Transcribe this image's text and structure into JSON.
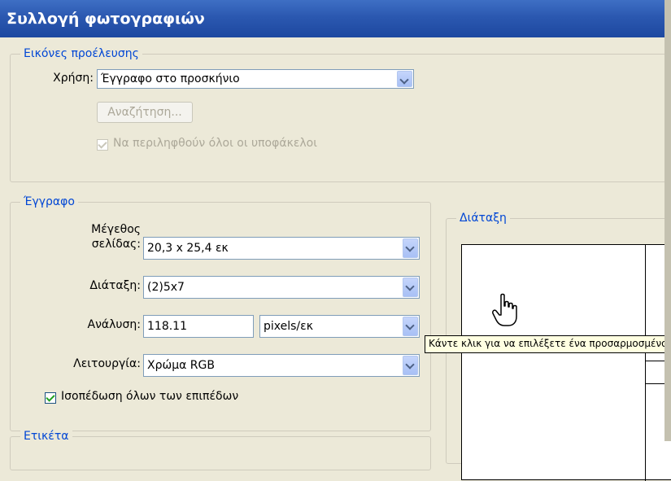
{
  "window": {
    "title": "Συλλογή φωτογραφιών"
  },
  "source": {
    "group_title": "Εικόνες προέλευσης",
    "use_label": "Χρήση:",
    "use_value": "Έγγραφο στο προσκήνιο",
    "browse_label": "Αναζήτηση...",
    "include_subfolders_label": "Να περιληφθούν όλοι οι υποφάκελοι",
    "include_subfolders_checked": true
  },
  "document": {
    "group_title": "Έγγραφο",
    "page_size_label_1": "Μέγεθος",
    "page_size_label_2": "σελίδας:",
    "page_size_value": "20,3 x 25,4 εκ",
    "layout_label": "Διάταξη:",
    "layout_value": "(2)5x7",
    "resolution_label": "Ανάλυση:",
    "resolution_value": "118.11",
    "resolution_unit": "pixels/εκ",
    "mode_label": "Λειτουργία:",
    "mode_value": "Χρώμα RGB",
    "flatten_label": "Ισοπέδωση όλων των επιπέδων",
    "flatten_checked": true
  },
  "label_group": {
    "group_title": "Ετικέτα"
  },
  "layout_preview": {
    "group_title": "Διάταξη"
  },
  "tooltip": {
    "text": "Κάντε κλικ για να επιλέξετε ένα προσαρμοσμένο"
  },
  "icons": {
    "cursor": "hand-pointer-icon"
  },
  "colors": {
    "title_bar": "#2b58b0",
    "group_title": "#0046d5",
    "check": "#21a121"
  }
}
